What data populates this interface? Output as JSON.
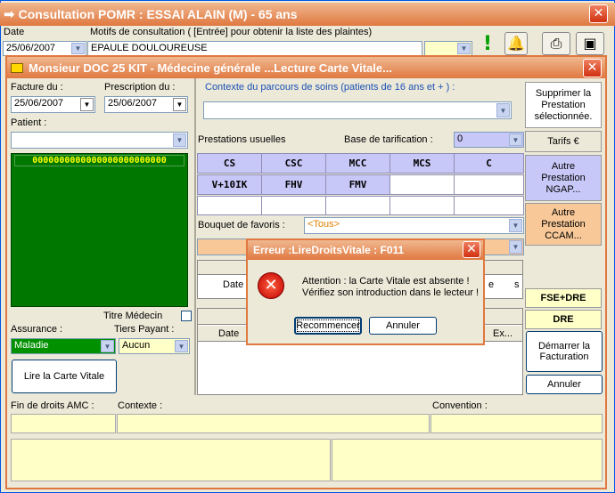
{
  "outer": {
    "title": "Consultation POMR : ESSAI ALAIN (M) -  65 ans",
    "date_label": "Date",
    "motifs_label": "Motifs de consultation ( [Entrée]  pour obtenir la liste des plaintes)",
    "date_value": "25/06/2007",
    "motif_value": "EPAULE DOULOUREUSE"
  },
  "inner": {
    "title": "Monsieur DOC 25 KIT - Médecine générale ...Lecture Carte Vitale...",
    "facture_label": "Facture du :",
    "prescription_label": "Prescription du :",
    "facture_value": "25/06/2007",
    "prescription_value": "25/06/2007",
    "patient_label": "Patient :",
    "card_number": "0000000000000000000000000",
    "titre_medecin_label": "Titre Médecin",
    "assurance_label": "Assurance :",
    "tiers_payant_label": "Tiers Payant :",
    "assurance_value": "Maladie",
    "tiers_payant_value": "Aucun",
    "lire_carte_label": "Lire la Carte Vitale",
    "contexte_label": "Contexte du parcours de soins (patients de 16 ans et + ) :",
    "prestations_label": "Prestations usuelles",
    "base_label": "Base de tarification :",
    "base_value": "0",
    "acts_row1": [
      "CS",
      "CSC",
      "MCC",
      "MCS",
      "C"
    ],
    "acts_row2": [
      "V+10IK",
      "FHV",
      "FMV"
    ],
    "bouquet_label": "Bouquet de favoris :",
    "bouquet_value": "<Tous>",
    "date_col": "Date",
    "date_col2": "Date",
    "col_e": "e",
    "col_s": "s",
    "col_ex": "Ex...",
    "supprimer_label": "Supprimer la Prestation sélectionnée.",
    "tarifs_label": "Tarifs €",
    "autre_ngap_label": "Autre Prestation NGAP...",
    "autre_ccam_label": "Autre Prestation CCAM...",
    "fse_dre_label": "FSE+DRE",
    "dre_label": "DRE",
    "demarrer_label": "Démarrer la Facturation",
    "annuler_label": "Annuler",
    "fin_droits_label": "Fin de droits AMC :",
    "contexte2_label": "Contexte :",
    "convention_label": "Convention :"
  },
  "dialog": {
    "title": "Erreur :LireDroitsVitale : F011",
    "message_line1": "Attention : la Carte Vitale est absente !",
    "message_line2": "Vérifiez son introduction dans le lecteur !",
    "recommencer_label": "Recommencer",
    "annuler_label": "Annuler"
  },
  "colors": {
    "title_orange": "#e07840",
    "card_green": "#007800",
    "purple_cell": "#c8c8f8",
    "orange_panel": "#f8c898",
    "yellow_field": "#ffffc8"
  }
}
